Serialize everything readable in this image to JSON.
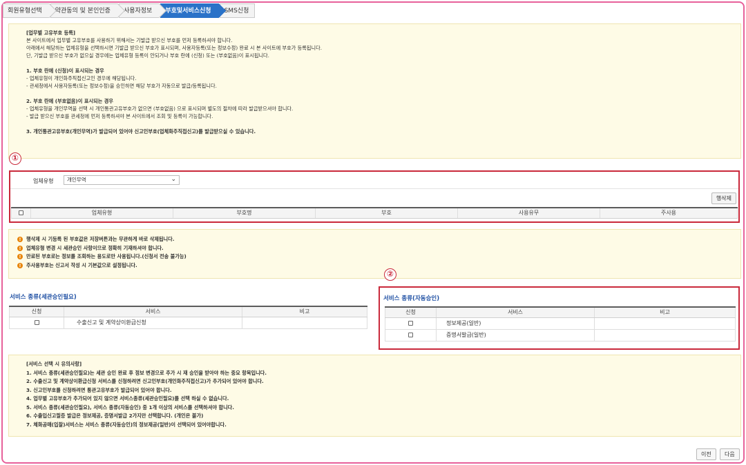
{
  "steps": [
    {
      "label": "회원유형선택"
    },
    {
      "label": "약관동의 및 본인인증"
    },
    {
      "label": "사용자정보"
    },
    {
      "label": "부호및서비스신청"
    },
    {
      "label": "SMS신청"
    }
  ],
  "notice1": [
    "[업무별 고유부호 등록]",
    "본 사이트에서 업무별 고유부호를 사용하기 위해서는 기발급 받으신 부호를 먼저 등록하셔야 합니다.",
    "아래에서 해당하는 업체유형을 선택하시면 기발급 받으신 부호가 표시되며, 사용자등록(또는 정보수정) 완료 시 본 사이트에 부호가 등록됩니다.",
    "단, 기발급 받으신 부호가 없으실 경우에는 업체유형 등록이 안되거나 부호 란에 (신청) 또는 (부호없음)이 표시됩니다.",
    "",
    "1. 부호 란에 (신청)이 표시되는 경우",
    "  - 업체유형이 개인화주직접신고인 경우에 해당됩니다.",
    "  - 관세청에서 사용자등록(또는 정보수정)을 승인하면 해당 부호가 자동으로 발급/등록됩니다.",
    "",
    "2. 부호 란에 (부호없음)이 표시되는 경우",
    "  - 업체유형을 개인무역을 선택 시 개인통관고유부호가 없으면 (부호없음) 으로 표시되며 별도의 절차에 따라 발급받으셔야 합니다.",
    "  - 발급 받으신 부호를 관세청에 먼저 등록하셔야 본 사이트에서 조회 및 등록이 가능합니다.",
    "",
    "3. 개인통관고유부호(개인무역)가 발급되어 있어야 신고인부호(업체화주직접신고)를 발급받으실 수 있습니다."
  ],
  "markers": {
    "one": "①",
    "two": "②"
  },
  "biz": {
    "label": "업체유형",
    "selected": "개인무역",
    "row_delete": "행삭제",
    "columns": [
      "업체유형",
      "부호명",
      "부호",
      "사용유무",
      "주사용"
    ]
  },
  "warnings": [
    "행삭제 시 기등록 된 부호값은 저장버튼과는 무관하게 바로 삭제됩니다.",
    "업체유형 변경 시 세관승인 사항이므로 정확히 기재하셔야 합니다.",
    "만료된 부호로는 정보를 조회하는 용도로만 사용됩니다.(신청서 전송 불가능)",
    "주사용부호는 신고서 작성 시 기본값으로 설정됩니다."
  ],
  "svc_left": {
    "title": "서비스 종류(세관승인필요)",
    "columns": [
      "신청",
      "서비스",
      "비고"
    ],
    "rows": [
      {
        "service": "수출신고 및 계약상이환급신청",
        "note": ""
      }
    ]
  },
  "svc_right": {
    "title": "서비스 종류(자동승인)",
    "columns": [
      "신청",
      "서비스",
      "비고"
    ],
    "rows": [
      {
        "service": "정보제공(일반)",
        "note": ""
      },
      {
        "service": "증명서발급(일반)",
        "note": ""
      }
    ]
  },
  "notice2": [
    "[서비스 선택 시 유의사항]",
    "1. 서비스 종류(세관승인필요)는 세관 승인 완료 후 정보 변경으로 추가 시 재 승인을 받아야 하는 중요 항목입니다.",
    "2. 수출신고 및 계약상이환급신청 서비스를 신청하려면 신고인부호(개인화주직접신고)가 추가되어 있어야 합니다.",
    "3. 신고인부호를 신청하려면 통관고유부호가 발급되어 있어야 합니다.",
    "4. 업무별 고유부호가 추가되어 있지 않으면 서비스종류(세관승인필요)를 선택 하실 수 없습니다.",
    "5. 서비스 종류(세관승인필요), 서비스 종류(자동승인) 중 1개 이상의 서비스를 선택하셔야 합니다.",
    "6. 수출입신고필증 발급은 정보제공, 증명서발급 2가지만 선택합니다. (개인은 불가)",
    "7. 체화공매(입찰)서비스는 서비스 종류(자동승인)의 정보제공(일반)이 선택되어 있어야합니다."
  ],
  "nav": {
    "prev": "이전",
    "next": "다음"
  }
}
